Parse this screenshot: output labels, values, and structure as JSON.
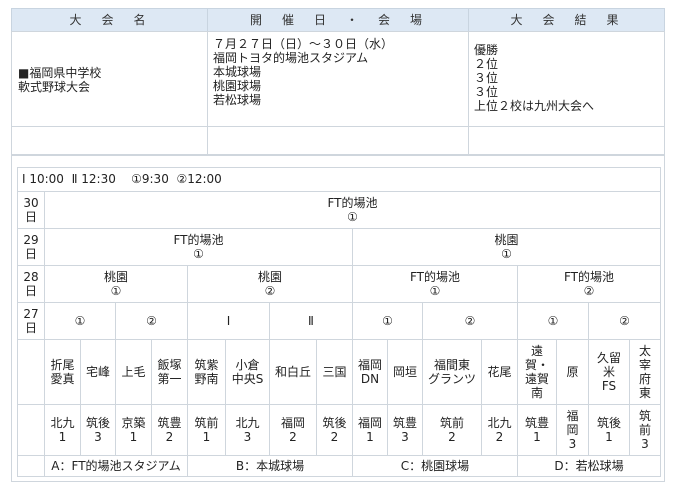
{
  "top_table": {
    "headers": [
      "大　会　名",
      "開　催　日　・　会　場",
      "大　会　結　果"
    ],
    "event_name": [
      "■福岡県中学校",
      "軟式野球大会"
    ],
    "dates_venues": [
      "７月２７日（日）～３０日（水）",
      "福岡トヨタ的場池スタジアム",
      "本城球場",
      "桃園球場",
      "若松球場"
    ],
    "results": [
      "優勝",
      "２位",
      "３位",
      "３位",
      "上位２校は九州大会へ"
    ]
  },
  "bracket": {
    "time_line": "Ⅰ 10:00  Ⅱ 12:30    ①9:30  ②12:00",
    "days": [
      "30\n日",
      "29\n日",
      "28\n日",
      "27\n日"
    ],
    "day30": [
      {
        "venue": "FT的場池",
        "game": "①"
      }
    ],
    "day29": [
      {
        "venue": "FT的場池",
        "game": "①"
      },
      {
        "venue": "桃園",
        "game": "①"
      }
    ],
    "day28": [
      {
        "venue": "桃園",
        "game": "①"
      },
      {
        "venue": "桃園",
        "game": "②"
      },
      {
        "venue": "FT的場池",
        "game": "①"
      },
      {
        "venue": "FT的場池",
        "game": "②"
      }
    ],
    "day27": [
      "①",
      "②",
      "Ⅰ",
      "Ⅱ",
      "①",
      "②",
      "①",
      "②"
    ],
    "teams": [
      {
        "name": "折尾\n愛真",
        "region": "北九\n1"
      },
      {
        "name": "宅峰",
        "region": "筑後\n3"
      },
      {
        "name": "上毛",
        "region": "京築\n1"
      },
      {
        "name": "飯塚\n第一",
        "region": "筑豊\n2"
      },
      {
        "name": "筑紫\n野南",
        "region": "筑前\n1"
      },
      {
        "name": "小倉\n中央S",
        "region": "北九\n3"
      },
      {
        "name": "和白丘",
        "region": "福岡\n2"
      },
      {
        "name": "三国",
        "region": "筑後\n2"
      },
      {
        "name": "福岡\nDN",
        "region": "福岡\n1"
      },
      {
        "name": "岡垣",
        "region": "筑豊\n3"
      },
      {
        "name": "福間東\nグランツ",
        "region": "筑前\n2"
      },
      {
        "name": "花尾",
        "region": "北九\n2"
      },
      {
        "name": "遠\n賀・\n遠賀\n南",
        "region": "筑豊\n1"
      },
      {
        "name": "原",
        "region": "福\n岡\n3"
      },
      {
        "name": "久留\n米\nFS",
        "region": "筑後\n1"
      },
      {
        "name": "太\n宰\n府\n東",
        "region": "筑\n前\n3"
      }
    ],
    "legend": [
      "A：FT的場池スタジアム",
      "B：本城球場",
      "C：桃園球場",
      "D：若松球場"
    ]
  }
}
